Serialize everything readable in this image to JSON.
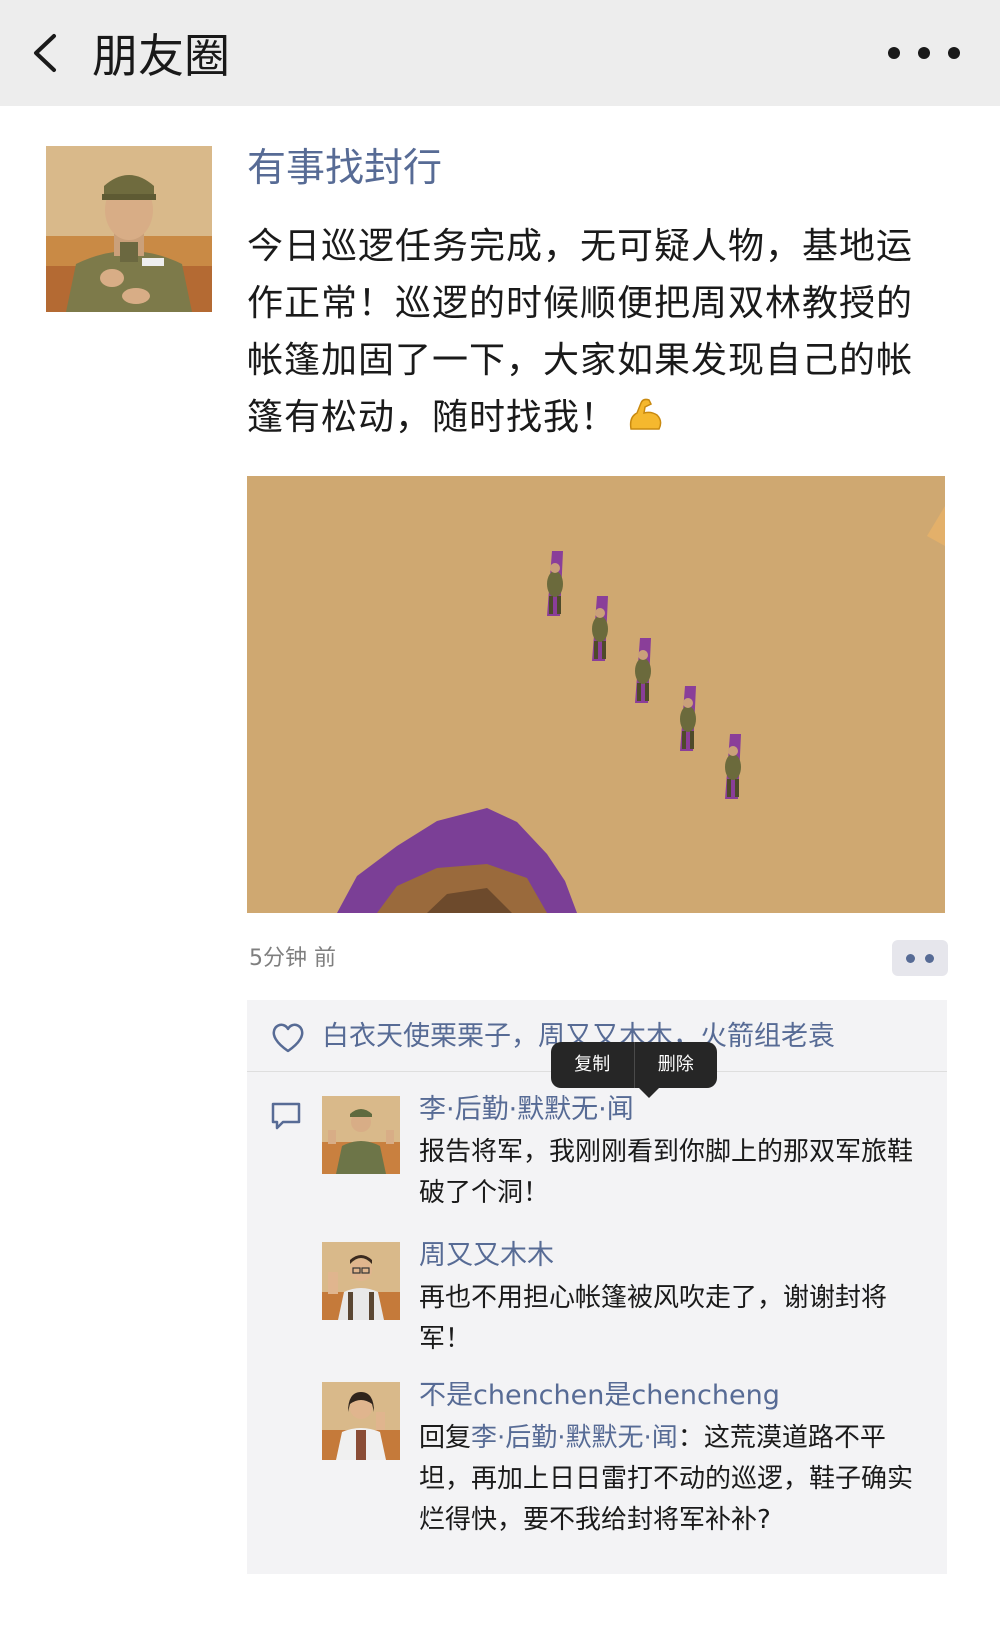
{
  "header": {
    "title": "朋友圈"
  },
  "post": {
    "author": "有事找封行",
    "text_lines": [
      "今日巡逻任务完成，无可疑人物，基地运",
      "作正常！巡逻的时候顺便把周双林教授的",
      "帐篷加固了一下，大家如果发现自己的帐",
      "篷有松动，随时找我！"
    ],
    "emoji": "flexed-biceps-emoji",
    "time": "5分钟 前"
  },
  "likes": {
    "text": "白衣天使栗栗子，周又又木木，火箭组老袁"
  },
  "popup": {
    "copy": "复制",
    "delete": "删除"
  },
  "comments": [
    {
      "name": "李·后勤·默默无·闻",
      "text": "报告将军，我刚刚看到你脚上的那双军旅鞋破了个洞！"
    },
    {
      "name": "周又又木木",
      "text": "再也不用担心帐篷被风吹走了，谢谢封将军！"
    },
    {
      "name": "不是chenchen是chencheng",
      "reply_prefix": "回复",
      "reply_to": "李·后勤·默默无·闻",
      "reply_sep": "：",
      "text": "这荒漠道路不平坦，再加上日日雷打不动的巡逻，鞋子确实烂得快，要不我给封将军补补?"
    }
  ],
  "colors": {
    "link": "#576b95",
    "header_bg": "#ededed",
    "box_bg": "#f3f3f5",
    "desert": "#c9a46d"
  }
}
